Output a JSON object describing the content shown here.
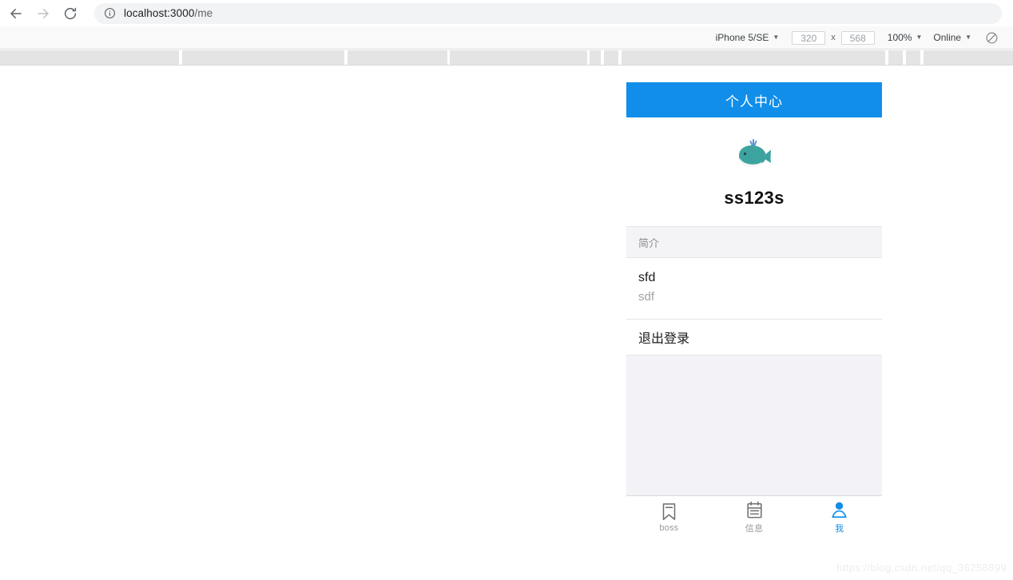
{
  "browser": {
    "back_icon": "arrow-left-icon",
    "forward_icon": "arrow-right-icon",
    "reload_icon": "reload-icon",
    "site_info_icon": "info-circle-icon",
    "url_host": "localhost:3000",
    "url_path": "/me"
  },
  "devtools": {
    "device_name": "iPhone 5/SE",
    "width_value": "320",
    "height_value": "568",
    "dimension_separator": "x",
    "zoom_value": "100%",
    "throttling_value": "Online",
    "media_query_icon": "no-throttling-icon",
    "caret_icon": "chevron-down-icon"
  },
  "app": {
    "header_title": "个人中心",
    "accent_color": "#108ee9",
    "avatar_icon": "whale-emoji-avatar",
    "username": "ss123s",
    "section_header": "简介",
    "intro": {
      "title": "sfd",
      "subtitle": "sdf"
    },
    "logout_label": "退出登录",
    "tabs": [
      {
        "label": "boss",
        "icon": "bookmark-icon",
        "active": false
      },
      {
        "label": "信息",
        "icon": "clipboard-icon",
        "active": false
      },
      {
        "label": "我",
        "icon": "person-icon",
        "active": true
      }
    ]
  },
  "watermark": {
    "text": "https://blog.csdn.net/qq_36258899"
  }
}
